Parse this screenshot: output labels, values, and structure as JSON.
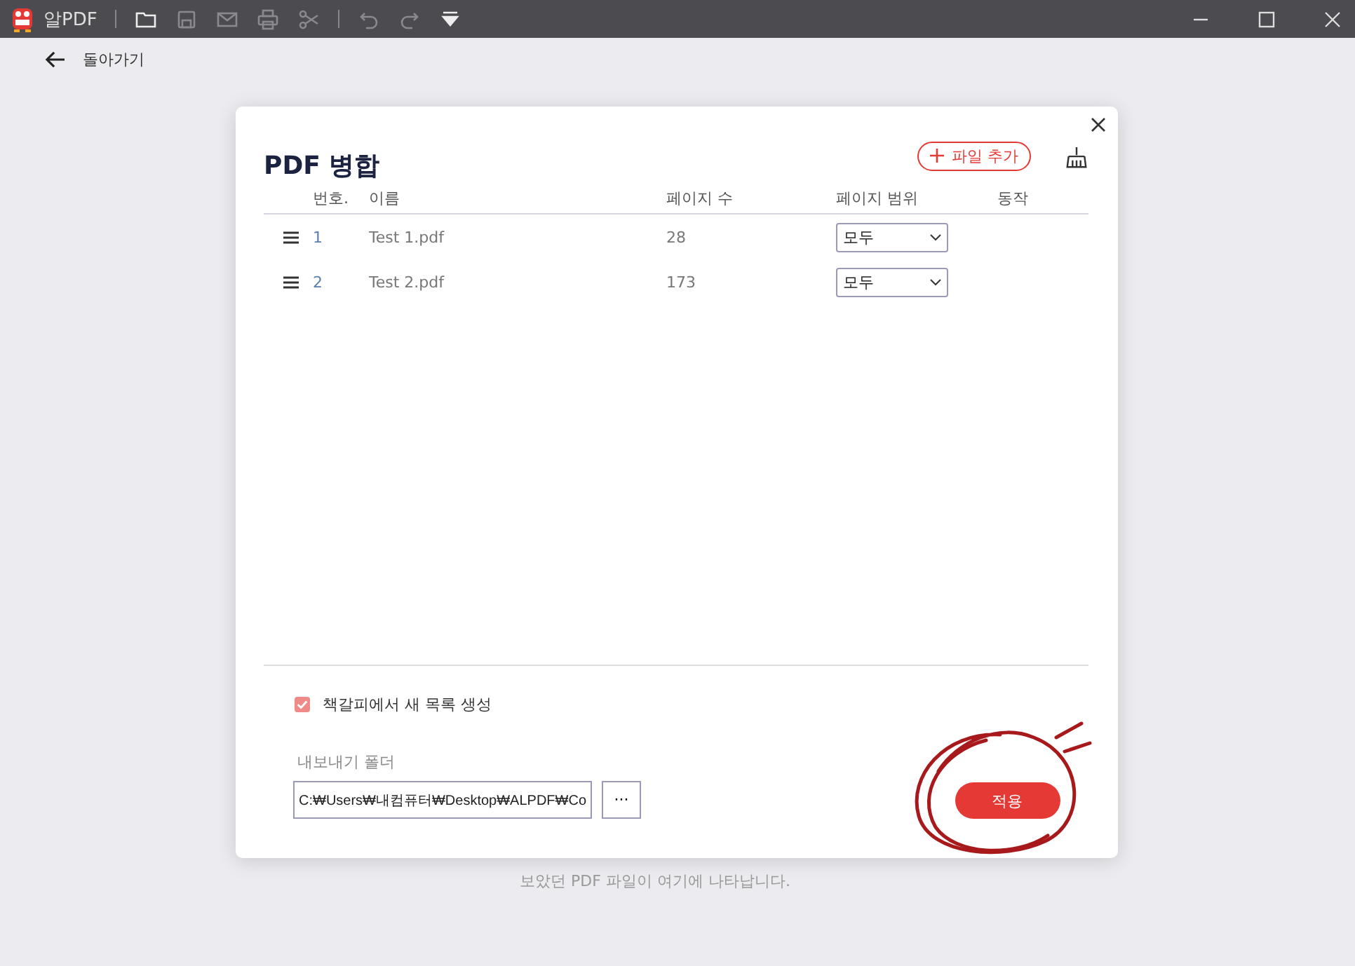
{
  "app": {
    "title": "알PDF"
  },
  "toolbar": [
    {
      "kind": "folder",
      "disabled": false
    },
    {
      "kind": "save",
      "disabled": true
    },
    {
      "kind": "mail",
      "disabled": true
    },
    {
      "kind": "print",
      "disabled": true
    },
    {
      "kind": "cut",
      "disabled": true
    },
    {
      "kind": "undo",
      "disabled": true
    },
    {
      "kind": "redo",
      "disabled": true
    },
    {
      "kind": "menu",
      "disabled": false
    }
  ],
  "back": {
    "label": "돌아가기"
  },
  "background": {
    "hint": "보았던 PDF 파일이 여기에 나타납니다."
  },
  "dialog": {
    "title": "PDF 병합",
    "add_button": "파일 추가",
    "columns": [
      "번호.",
      "이름",
      "페이지 수",
      "페이지 범위",
      "동작"
    ],
    "rows": [
      {
        "number": "1",
        "name": "Test 1.pdf",
        "pages": "28",
        "range": "모두"
      },
      {
        "number": "2",
        "name": "Test 2.pdf",
        "pages": "173",
        "range": "모두"
      }
    ],
    "bookmark_option": {
      "label": "책갈피에서 새 목록 생성",
      "checked": true
    },
    "export_folder": {
      "label": "내보내기 폴더",
      "value": "C:₩Users₩내컴퓨터₩Desktop₩ALPDF₩Co"
    },
    "browse_button": "···",
    "apply_button": "적용"
  }
}
